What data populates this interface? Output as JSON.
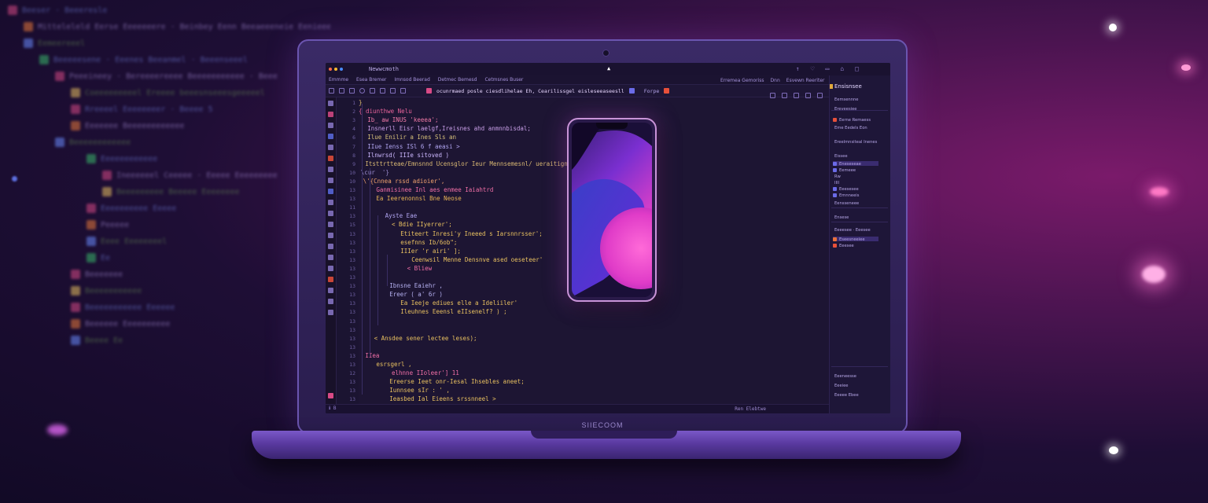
{
  "window": {
    "title": "Newwcmoth",
    "right_glyphs": [
      "↑",
      "♡",
      "▭",
      "⌂",
      "□"
    ]
  },
  "menubar": {
    "items": [
      "Emmme",
      "Esea Bremer",
      "Imnsod Beerad",
      "Detmec Bemesd",
      "Cetmsnes Buser"
    ],
    "right_items": [
      "Erremea Gemoriss",
      "Dnn",
      "Esvewn Reeriter"
    ]
  },
  "toolbar": {
    "path_text": "ocunrmaed posle ciesdlihelae Eh, Cearilissgel eisleseeaseesll",
    "filename": "Forpe"
  },
  "editor": {
    "line_numbers": [
      "1",
      "2",
      "3",
      "4",
      "6",
      "7",
      "8",
      "9",
      "10",
      "10",
      "13",
      "13",
      "11",
      "13",
      "15",
      "13",
      "13",
      "13",
      "13",
      "13",
      "13",
      "13",
      "13",
      "13",
      "13",
      "13",
      "13",
      "13",
      "13",
      "13",
      "13",
      "12",
      "13",
      "13",
      "13",
      "13",
      "13",
      "13"
    ],
    "lines": [
      {
        "text": "}",
        "color": "#e0c070",
        "indent": 0
      },
      {
        "text": "{ diunthwe Nelu",
        "color": "#e8639a",
        "indent": 0
      },
      {
        "text": "Ib_ aw INUS 'keeea';",
        "color": "#f27aa8",
        "indent": 8
      },
      {
        "text": "Insnerll Eisr laelgf,Ireisnes ahd anmnnbisdal;",
        "color": "#c99fe8",
        "indent": 8
      },
      {
        "text": "Ilue Enilir a Ines Sls an",
        "color": "#d6c07a",
        "indent": 8
      },
      {
        "text": "IIue Ienss ISl 6 f aeasi >",
        "color": "#b0a4f0",
        "indent": 8
      },
      {
        "text": "Ilnwrsd( IIIe sitoved )",
        "color": "#cdb8ff",
        "indent": 8
      },
      {
        "text": "Itsttrtteae/Emnsnnd Ucensglor Ieur Mennsemesnl/ ueraitignhtel;",
        "color": "#d9b873",
        "indent": 6
      },
      {
        "text": "\\cur  '}",
        "color": "#9c8dcf",
        "indent": 2
      },
      {
        "text": "\\'{Cnnea rssd adioier',",
        "color": "#f1a36e",
        "indent": 4
      },
      {
        "text": "Ganmisinee Inl aes enmee Iaiahtrd",
        "color": "#f06fa6",
        "indent": 16
      },
      {
        "text": "Ea Ieerenonnsl Bne Neose",
        "color": "#e8b455",
        "indent": 16
      },
      {
        "text": "",
        "color": "#9c8dcf",
        "indent": 0
      },
      {
        "text": "Ayste Eae",
        "color": "#b0a4f0",
        "indent": 24
      },
      {
        "text": "< Bdie IIyerrer';",
        "color": "#e8c060",
        "indent": 30
      },
      {
        "text": "Etiteert Inresi'y Ineeed s Iarsnnrsser';",
        "color": "#e8c060",
        "indent": 38
      },
      {
        "text": "esefnns Ib/6ob\";",
        "color": "#e8c060",
        "indent": 38
      },
      {
        "text": "IIIer 'r airi' ];",
        "color": "#e8c060",
        "indent": 38
      },
      {
        "text": "Ceenwsil Menne Densnve ased oeseteer'",
        "color": "#e8c060",
        "indent": 48
      },
      {
        "text": "< Bliew",
        "color": "#f06fa6",
        "indent": 44
      },
      {
        "text": "",
        "color": "#9c8dcf",
        "indent": 0
      },
      {
        "text": "Ibnsne Eaiehr ,",
        "color": "#b5b0f0",
        "indent": 28
      },
      {
        "text": "Ereer ( a' 6r )",
        "color": "#b5b0f0",
        "indent": 28
      },
      {
        "text": "Ea Ieeje ediues elle a Ideliiler'",
        "color": "#e8c060",
        "indent": 38
      },
      {
        "text": "Ileuhnes Eeensl eIIsenelf? ) ;",
        "color": "#e8c060",
        "indent": 38
      },
      {
        "text": "",
        "color": "#9c8dcf",
        "indent": 0
      },
      {
        "text": "",
        "color": "#9c8dcf",
        "indent": 0
      },
      {
        "text": "< Ansdee sener lectee leses);",
        "color": "#e8c060",
        "indent": 14
      },
      {
        "text": "",
        "color": "#9c8dcf",
        "indent": 0
      },
      {
        "text": "IIea",
        "color": "#f06fa6",
        "indent": 6
      },
      {
        "text": "esrsgerl ,",
        "color": "#e8c060",
        "indent": 16
      },
      {
        "text": "elhnne IIoleer'] 11",
        "color": "#f06fa6",
        "indent": 30
      },
      {
        "text": "Ereerse Ieet onr-Iesal Ihsebles aneet;",
        "color": "#e8c060",
        "indent": 28
      },
      {
        "text": "Iunnsee sIr : ' ,",
        "color": "#e8c060",
        "indent": 28
      },
      {
        "text": "Ieasbed Ial Eieens srssnneel >",
        "color": "#e8c060",
        "indent": 28
      }
    ],
    "code_colors": {
      "keyword": "#e8639a",
      "string": "#e8c060",
      "identifier": "#b0a4f0",
      "number": "#f1a36e"
    }
  },
  "status_bar": {
    "left": "ℹ B",
    "right": "Ren Elebtwe"
  },
  "right_panel": {
    "title": "Ensisnsee",
    "items": [
      {
        "text": "Eemsennne",
        "selected": false
      },
      {
        "text": "Ereveesiee",
        "selected": false
      },
      {
        "text": "Eerne Remaess",
        "selected": false
      },
      {
        "text": "Eme Eedels Eon",
        "selected": false
      },
      {
        "text": "Ereelmnsiteal Inenes",
        "selected": false
      },
      {
        "text": "Eissee",
        "selected": false
      },
      {
        "text": "Eneseseae",
        "selected": true
      },
      {
        "text": "Eemeee",
        "selected": false
      },
      {
        "text": "Rw",
        "selected": false
      },
      {
        "text": "IIII",
        "selected": false
      },
      {
        "text": "Eeesesee",
        "selected": false
      },
      {
        "text": "Emnneeis",
        "selected": false
      },
      {
        "text": "Eensseneee",
        "selected": false
      },
      {
        "text": "Ensese",
        "selected": false
      },
      {
        "text": "Eeeesee · Eeesee",
        "selected": false
      },
      {
        "text": "Eseesneeiee",
        "selected": true
      },
      {
        "text": "Eeesee",
        "selected": false
      },
      {
        "text": "Eeeneesse",
        "selected": false
      },
      {
        "text": "Eeeiee",
        "selected": false
      },
      {
        "text": "Eeeee Ebee",
        "selected": false
      }
    ]
  },
  "laptop": {
    "brand": "SIIECOOM"
  },
  "background": {
    "labels": [
      {
        "text": "Beeser · Beeeresle",
        "indent": 0
      },
      {
        "text": "Mitteleleld Eerse Eeeeeeere · Beinbey Eenn Beeaeeeneie Eenieee",
        "indent": 1
      },
      {
        "text": "Eemeereeel",
        "indent": 1
      },
      {
        "text": "Beeeeesene · Eeenes Beeanmel · Beeenseeel",
        "indent": 2
      },
      {
        "text": "Peeeineey · Bereeeereeee Beeeeeeeeeee · Beee",
        "indent": 3
      },
      {
        "text": "Coeeeeeeeeel Ereeee beeesnseeesgeeeeel",
        "indent": 4
      },
      {
        "text": "Rreeeel Eeeeeeeer · Beeee 5",
        "indent": 4
      },
      {
        "text": "Eeeeeee Beeeeeeeeeeee",
        "indent": 4
      },
      {
        "text": "Beeeeeeeeeeee",
        "indent": 3
      },
      {
        "text": "Eeeeeeeeeeee",
        "indent": 5
      },
      {
        "text": "Ineeeeeel Ceeeee · Eeeee Eeeeeeeee",
        "indent": 6
      },
      {
        "text": "Beeeeeeeee Beeeee Eeeeeeee",
        "indent": 6
      },
      {
        "text": "Eeeeeeeeee Eeeee",
        "indent": 5
      },
      {
        "text": "Peeeee",
        "indent": 5
      },
      {
        "text": "Eeee Eeeeeeeel",
        "indent": 5
      },
      {
        "text": "Ee",
        "indent": 5
      },
      {
        "text": "Beeeeeee",
        "indent": 4
      },
      {
        "text": "Beeeeeeeeeee",
        "indent": 4
      },
      {
        "text": "Beeeeeeeeeee Eeeeee",
        "indent": 4
      },
      {
        "text": "Beeeeee Eeeeeeeeee",
        "indent": 4
      },
      {
        "text": "Beeee Ee",
        "indent": 4
      }
    ]
  }
}
